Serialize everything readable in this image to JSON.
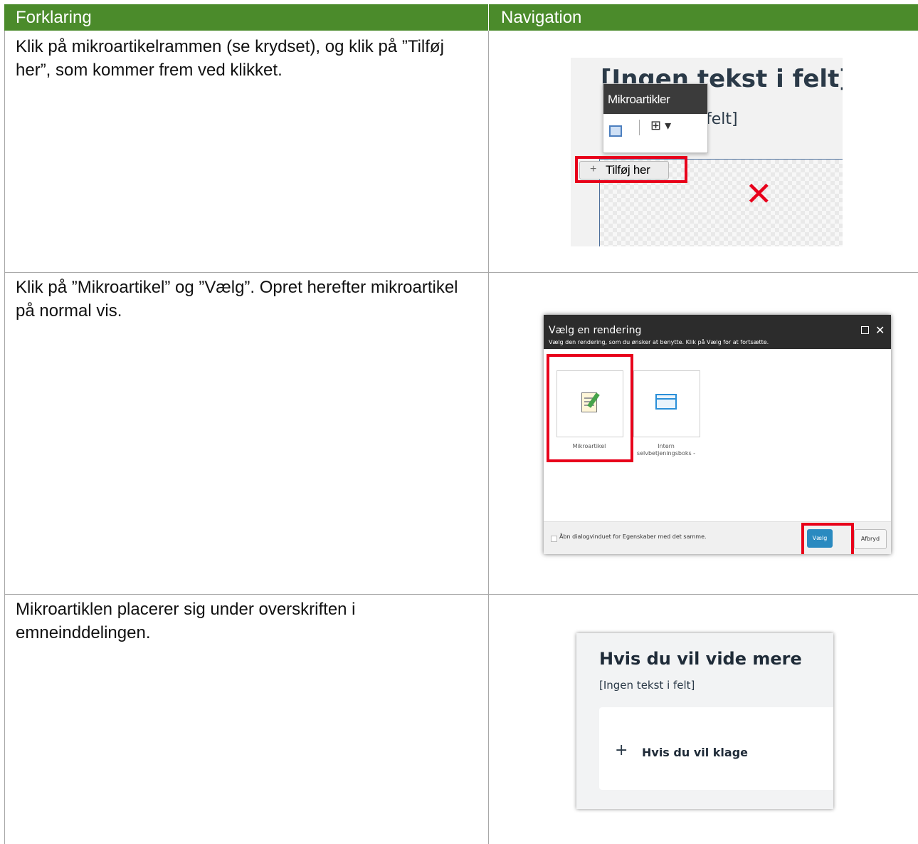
{
  "table": {
    "headers": [
      "Forklaring",
      "Navigation"
    ],
    "rows": [
      {
        "explanation": "Klik på mikroartikelrammen (se krydset), og klik på ”Tilføj her”, som kommer frem ved klikket."
      },
      {
        "explanation": "Klik på ”Mikroartikel” og ”Vælg”. Opret herefter mikroartikel på normal vis."
      },
      {
        "explanation": "Mikroartiklen placerer sig under overskriften i emneinddelingen."
      }
    ]
  },
  "shot1": {
    "title": "[Ingen tekst i felt]",
    "subtitle_fragment": "felt]",
    "popup_title": "Mikroartikler",
    "add_button": "Tilføj her",
    "cross_mark": "✕"
  },
  "shot2": {
    "dialog_title": "Vælg en rendering",
    "dialog_subtitle": "Vælg den rendering, som du ønsker at benytte. Klik på Vælg for at fortsætte.",
    "tiles": [
      {
        "label": "Mikroartikel",
        "icon": "notepad-pencil-icon"
      },
      {
        "label": "Intern selvbetjeningsboks -",
        "icon": "window-icon"
      }
    ],
    "checkbox_label": "Åbn dialogvinduet for Egenskaber med det samme.",
    "ok_button": "Vælg",
    "cancel_button": "Afbryd"
  },
  "shot3": {
    "title": "Hvis du vil vide mere",
    "subtitle": "[Ingen tekst i felt]",
    "item": "Hvis du vil klage"
  },
  "colors": {
    "header_bg": "#4b8b2b",
    "highlight": "#e8001b",
    "button_blue": "#2a8ac0"
  }
}
